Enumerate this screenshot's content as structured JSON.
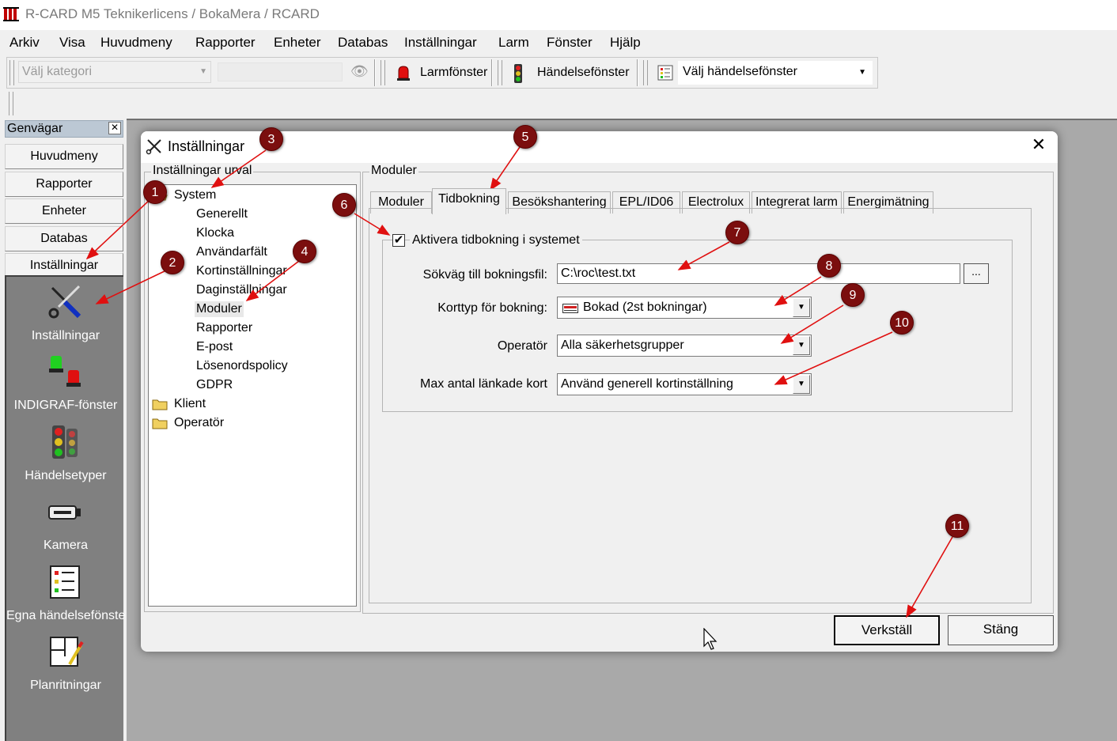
{
  "window": {
    "title": "R-CARD M5 Teknikerlicens   / BokaMera / RCARD"
  },
  "menu": [
    "Arkiv",
    "Visa",
    "Huvudmeny",
    "Rapporter",
    "Enheter",
    "Databas",
    "Inställningar",
    "Larm",
    "Fönster",
    "Hjälp"
  ],
  "toolbar": {
    "category_placeholder": "Välj kategori",
    "alarm_window": "Larmfönster",
    "event_window": "Händelsefönster",
    "choose_event_window": "Välj händelsefönster"
  },
  "shortcuts": {
    "title": "Genvägar",
    "close": "✕",
    "buttons": [
      "Huvudmeny",
      "Rapporter",
      "Enheter",
      "Databas",
      "Inställningar"
    ],
    "icons": [
      {
        "label": "Inställningar",
        "icon": "tools-icon"
      },
      {
        "label": "INDIGRAF-fönster",
        "icon": "indigraf-lights-icon"
      },
      {
        "label": "Händelsetyper",
        "icon": "traffic-light-icon"
      },
      {
        "label": "Kamera",
        "icon": "camera-icon"
      },
      {
        "label": "Egna händelsefönster",
        "icon": "custom-event-window-icon"
      },
      {
        "label": "Planritningar",
        "icon": "floorplan-icon"
      }
    ]
  },
  "dialog": {
    "title": "Inställningar",
    "close": "✕",
    "tree_group": "Inställningar urval",
    "tree": {
      "system": "System",
      "system_children": [
        "Generellt",
        "Klocka",
        "Användarfält",
        "Kortinställningar",
        "Daginställningar",
        "Moduler",
        "Rapporter",
        "E-post",
        "Lösenordspolicy",
        "GDPR"
      ],
      "klient": "Klient",
      "operator": "Operatör"
    },
    "modules_group": "Moduler",
    "tabs": [
      "Moduler",
      "Tidbokning",
      "Besökshantering",
      "EPL/ID06",
      "Electrolux",
      "Integrerat larm",
      "Energimätning"
    ],
    "active_tab": "Tidbokning",
    "booking": {
      "enable_label": "Aktivera tidbokning i systemet",
      "enable_checked": "✔",
      "path_label": "Sökväg till bokningsfil:",
      "path_value": "C:\\roc\\test.txt",
      "browse": "...",
      "cardtype_label": "Korttyp för bokning:",
      "cardtype_value": "Bokad (2st bokningar)",
      "operator_label": "Operatör",
      "operator_value": "Alla säkerhetsgrupper",
      "maxlinked_label": "Max antal länkade kort",
      "maxlinked_value": "Använd generell kortinställning"
    },
    "apply": "Verkställ",
    "close_button": "Stäng"
  },
  "annotation_markers": [
    "1",
    "2",
    "3",
    "4",
    "5",
    "6",
    "7",
    "8",
    "9",
    "10",
    "11"
  ],
  "colors": {
    "marker": "#7b0e0e",
    "arrow": "#e01010",
    "workspace": "#a9a9a9"
  }
}
